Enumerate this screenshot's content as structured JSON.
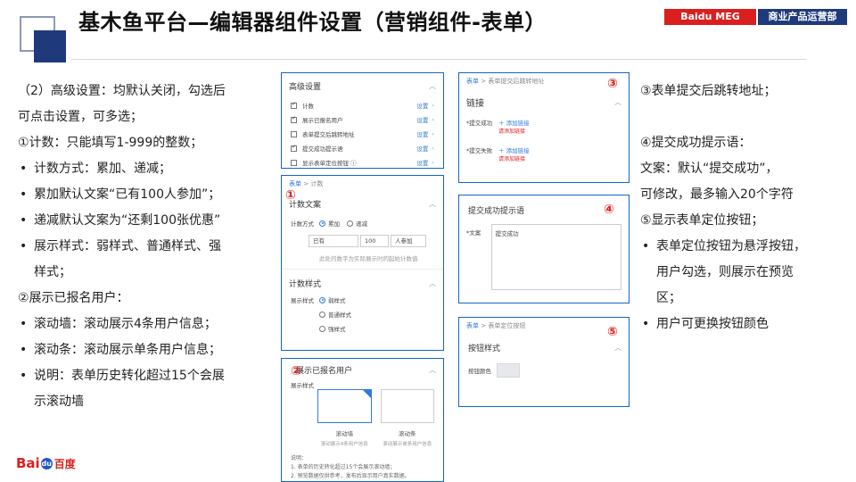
{
  "header": {
    "title": "基木鱼平台—编辑器组件设置（营销组件-表单）",
    "tag_meg": "Baidu MEG",
    "tag_dept": "商业产品运营部"
  },
  "left_text": {
    "l1": "（2）高级设置：均默认关闭，勾选后",
    "l2": "可点击设置，可多选；",
    "l3": "①计数：只能填写1-999的整数；",
    "b1": "计数方式：累加、递减；",
    "b2": "累加默认文案“已有100人参加”；",
    "b3": "递减默认文案为“还剩100张优惠”",
    "b4a": "展示样式：弱样式、普通样式、强",
    "b4b": "样式；",
    "l4": "②展示已报名用户：",
    "b5": "滚动墙：滚动展示4条用户信息；",
    "b6": "滚动条：滚动展示单条用户信息；",
    "b7a": "说明：表单历史转化超过15个会展",
    "b7b": "示滚动墙"
  },
  "right_text": {
    "l1": "③表单提交后跳转地址；",
    "l2": "④提交成功提示语：",
    "l3": "文案：默认“提交成功”，",
    "l4": "可修改，最多输入20个字符",
    "l5": "⑤显示表单定位按钮；",
    "b1a": "表单定位按钮为悬浮按钮，",
    "b1b": "用户勾选，则展示在预览",
    "b1c": "区；",
    "b2": "用户可更换按钮颜色"
  },
  "panel_adv": {
    "title": "高级设置",
    "items": [
      {
        "label": "计数",
        "setting": "设置"
      },
      {
        "label": "展示已报名用户",
        "setting": "设置"
      },
      {
        "label": "表单提交后跳转地址",
        "setting": "设置"
      },
      {
        "label": "提交成功提示语",
        "setting": "设置"
      },
      {
        "label": "显示表单定位按钮 ⓘ",
        "setting": "设置"
      }
    ]
  },
  "panel_count": {
    "num": "①",
    "crumb_link": "表单",
    "crumb_sep": ">",
    "crumb_cur": "计数",
    "title": "计数文案",
    "method_label": "计数方式",
    "opt_add": "累加",
    "opt_sub": "递减",
    "input_pre": "已有",
    "input_num": "100",
    "input_post": "人参加",
    "hint": "此处的数字为实际展示时的起始计数值",
    "style_title": "计数样式",
    "style_label": "展示样式",
    "style_opts": [
      "弱样式",
      "普通样式",
      "强样式"
    ]
  },
  "panel_users": {
    "num": "②",
    "title": "展示已报名用户",
    "style_label": "展示样式",
    "opt1": "滚动墙",
    "opt1_sub": "滚动展示4条用户信息",
    "opt2": "滚动条",
    "opt2_sub": "滚动展示单条用户信息",
    "note_title": "说明：",
    "note1": "1. 表单的历史转化超过15个会展示滚动墙；",
    "note2": "2. 预览数据仅供参考，发布后显示用户真实数据。"
  },
  "panel_link": {
    "num": "③",
    "crumb_link": "表单",
    "crumb_sep": ">",
    "crumb_cur": "表单提交后跳转地址",
    "title": "链接",
    "success_label": "*提交成功",
    "fail_label": "*提交失败",
    "add_link": "＋ 添加链接",
    "add_hint": "请添加链接"
  },
  "panel_tip": {
    "num": "④",
    "title": "提交成功提示语",
    "label": "*文案",
    "value": "提交成功"
  },
  "panel_btn": {
    "num": "⑤",
    "crumb_link": "表单",
    "crumb_sep": ">",
    "crumb_cur": "表单定位按钮",
    "title": "按钮样式",
    "color_label": "按钮颜色"
  },
  "logo": {
    "bai": "Bai",
    "paw": "du",
    "cn": "百度"
  }
}
